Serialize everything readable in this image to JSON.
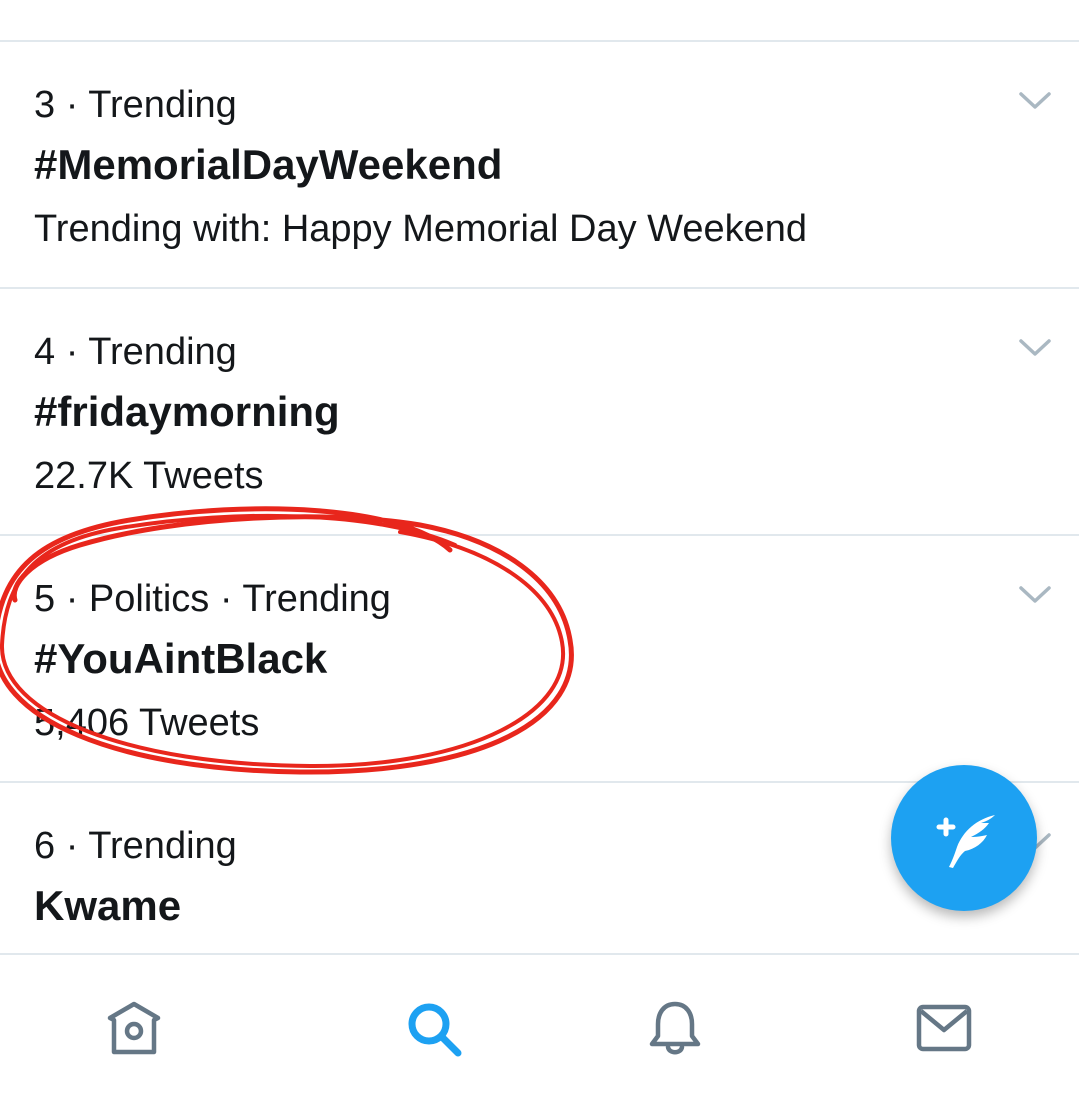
{
  "trends": [
    {
      "meta": "3 · Trending",
      "name": "#MemorialDayWeekend",
      "sub": "Trending with: Happy Memorial Day Weekend"
    },
    {
      "meta": "4 · Trending",
      "name": "#fridaymorning",
      "sub": "22.7K Tweets"
    },
    {
      "meta": "5 · Politics · Trending",
      "name": "#YouAintBlack",
      "sub": "5,406 Tweets"
    },
    {
      "meta": "6 · Trending",
      "name": "Kwame"
    }
  ],
  "fab": {
    "icon": "compose-tweet-icon"
  },
  "bottom_nav": {
    "items": [
      {
        "icon": "home-icon",
        "active": false
      },
      {
        "icon": "search-icon",
        "active": true
      },
      {
        "icon": "notifications-bell-icon",
        "active": false
      },
      {
        "icon": "messages-envelope-icon",
        "active": false
      }
    ]
  },
  "colors": {
    "accent": "#1da1f2",
    "text": "#14171a",
    "icon_inactive": "#657786",
    "chevron": "#aab8c2",
    "divider": "#e1e8ed",
    "annotation": "#e8261c"
  }
}
